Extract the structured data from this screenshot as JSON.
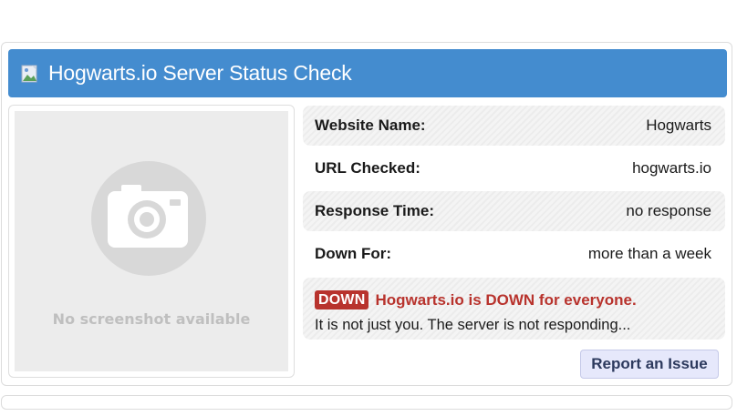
{
  "header": {
    "title": "Hogwarts.io Server Status Check",
    "icon": "broken-image-icon"
  },
  "screenshot": {
    "placeholder_text": "No screenshot available",
    "icon": "camera-icon"
  },
  "info_rows": [
    {
      "label": "Website Name:",
      "value": "Hogwarts"
    },
    {
      "label": "URL Checked:",
      "value": "hogwarts.io"
    },
    {
      "label": "Response Time:",
      "value": "no response"
    },
    {
      "label": "Down For:",
      "value": "more than a week"
    }
  ],
  "status": {
    "badge": "DOWN",
    "headline": "Hogwarts.io is DOWN for everyone.",
    "detail": "It is not just you. The server is not responding..."
  },
  "actions": {
    "report_label": "Report an Issue"
  },
  "colors": {
    "header_bg": "#448ccf",
    "down_red": "#b8332d",
    "button_bg": "#e6e8fb"
  }
}
